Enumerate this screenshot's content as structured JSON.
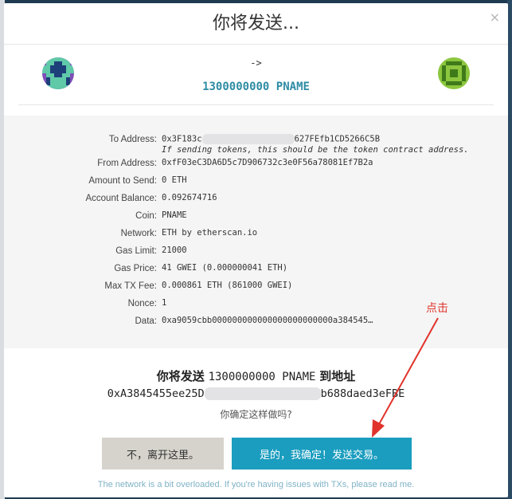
{
  "modal": {
    "title": "你将发送...",
    "close_label": "×"
  },
  "summary": {
    "arrow": "->",
    "amount": "1300000000 PNAME"
  },
  "details": [
    {
      "label": "To Address:",
      "value_start": "0x3F183c",
      "value_end": "627FEfb1CD5266C5B",
      "note": "If sending tokens, this should be the token contract address."
    },
    {
      "label": "From Address:",
      "value": "0xfF03eC3DA6D5c7D906732c3e0F56a78081Ef7B2a"
    },
    {
      "label": "Amount to Send:",
      "value": "0 ETH"
    },
    {
      "label": "Account Balance:",
      "value": "0.092674716"
    },
    {
      "label": "Coin:",
      "value": "PNAME"
    },
    {
      "label": "Network:",
      "value": "ETH by etherscan.io"
    },
    {
      "label": "Gas Limit:",
      "value": "21000"
    },
    {
      "label": "Gas Price:",
      "value": "41 GWEI (0.000000041 ETH)"
    },
    {
      "label": "Max TX Fee:",
      "value": "0.000861 ETH (861000 GWEI)"
    },
    {
      "label": "Nonce:",
      "value": "1"
    },
    {
      "label": "Data:",
      "value": "0xa9059cbb000000000000000000000000a384545…"
    }
  ],
  "confirm": {
    "prefix": "你将发送",
    "amount": "1300000000 PNAME",
    "suffix": "到地址",
    "address_start": "0xA3845455ee25D",
    "address_end": "b688daed3eFBE",
    "question": "你确定这样做吗?"
  },
  "buttons": {
    "cancel": "不，离开这里。",
    "confirm": "是的，我确定！发送交易。"
  },
  "footer": "The network is a bit overloaded. If you're having issues with TXs, please read me.",
  "annotation": "点击",
  "colors": {
    "accent": "#1a9dbf",
    "amount": "#2e8ca5",
    "annotation": "#e0332b"
  }
}
